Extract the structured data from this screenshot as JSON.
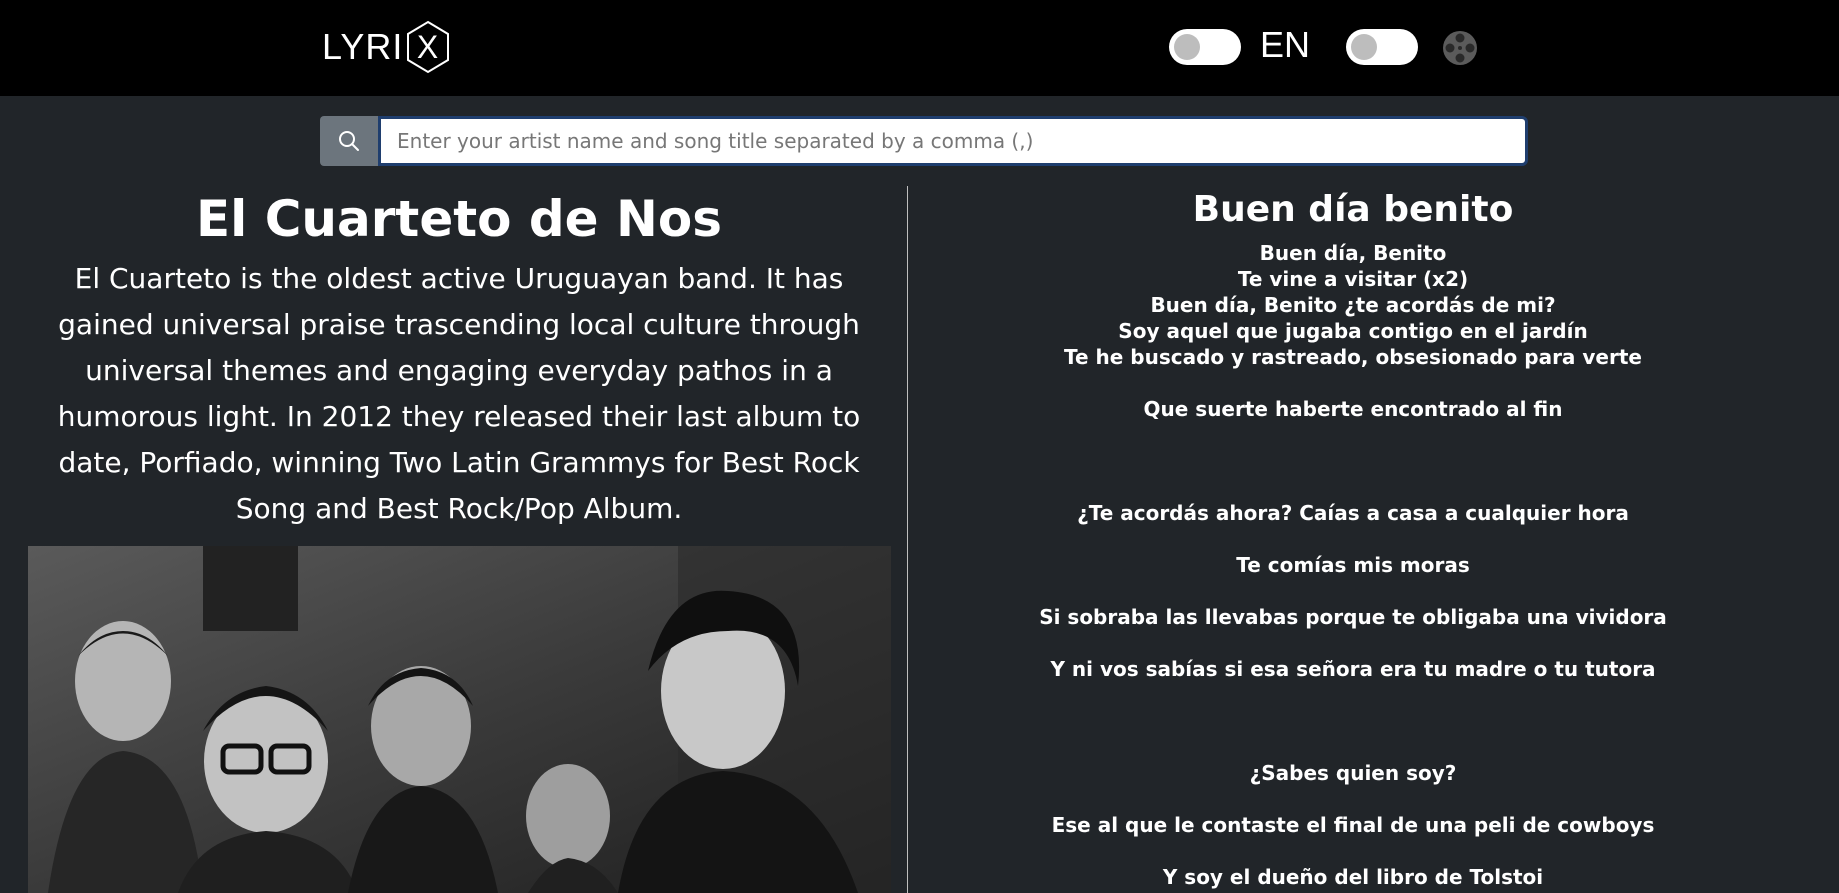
{
  "header": {
    "logo_text": "LYRI",
    "logo_mark": "X",
    "language_label": "EN",
    "icons": [
      "film-reel-icon"
    ]
  },
  "search": {
    "placeholder": "Enter your artist name and song title separated by a comma (,)",
    "value": "",
    "icon": "search-icon"
  },
  "artist": {
    "name": "El Cuarteto de Nos",
    "bio": "El Cuarteto is the oldest active Uruguayan band. It has gained universal praise trascending local culture through universal themes and engaging everyday pathos in a humorous light. In 2012 they released their last album to date, Porfiado, winning Two Latin Grammys for Best Rock Song and Best Rock/Pop Album."
  },
  "song": {
    "title": "Buen día benito",
    "lyrics": [
      "Buen día, Benito",
      "Te vine a visitar (x2)",
      "Buen día, Benito ¿te acordás de mi?",
      "Soy aquel que jugaba contigo en el jardín",
      "Te he buscado y rastreado, obsesionado para verte",
      "",
      "Que suerte haberte encontrado al fin",
      "",
      "",
      "",
      "¿Te acordás ahora? Caías a casa a cualquier hora",
      "",
      "Te comías mis moras",
      "",
      "Si sobraba las llevabas porque te obligaba una vividora",
      "",
      "Y ni vos sabías si esa señora era tu madre o tu tutora",
      "",
      "",
      "",
      "¿Sabes quien soy?",
      "",
      "Ese al que le contaste el final de una peli de cowboys",
      "",
      "Y soy el dueño del libro de Tolstoi"
    ]
  },
  "colors": {
    "navbar": "#000000",
    "background": "#212529",
    "search_button": "#6c757d",
    "input_border": "#1f3e6e"
  }
}
